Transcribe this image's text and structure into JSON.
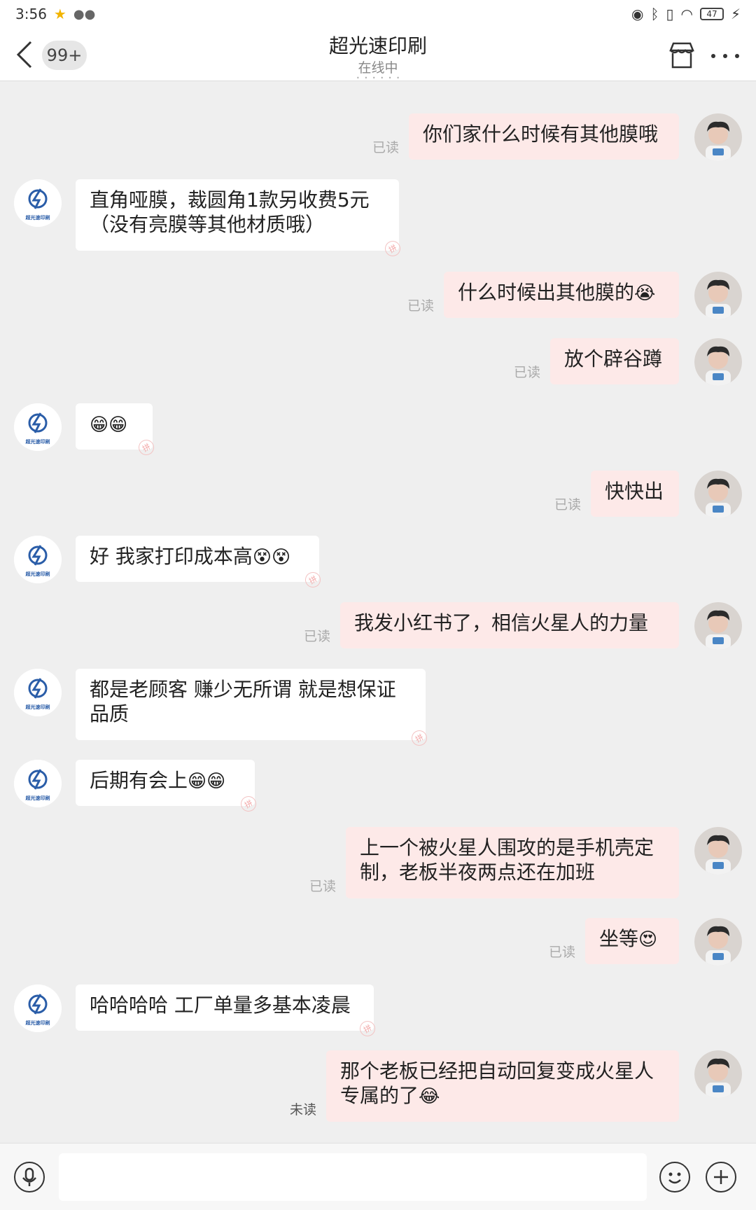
{
  "status_bar": {
    "time": "3:56",
    "battery": "47"
  },
  "header": {
    "unread_count": "99+",
    "title": "超光速印刷",
    "status": "在线中"
  },
  "messages": [
    {
      "side": "right",
      "text": "你们家什么时候有其他膜哦",
      "read": "已读"
    },
    {
      "side": "left",
      "text": "直角哑膜，裁圆角1款另收费5元\n（没有亮膜等其他材质哦）"
    },
    {
      "side": "right",
      "text": "什么时候出其他膜的",
      "emoji": "😭",
      "read": "已读"
    },
    {
      "side": "right",
      "text": "放个辟谷蹲",
      "read": "已读"
    },
    {
      "side": "left",
      "text": "",
      "emoji": "😁😁"
    },
    {
      "side": "right",
      "text": "快快出",
      "read": "已读"
    },
    {
      "side": "left",
      "text": "好 我家打印成本高",
      "emoji": "😵😵"
    },
    {
      "side": "right",
      "text": "我发小红书了，相信火星人的力量",
      "read": "已读"
    },
    {
      "side": "left",
      "text": "都是老顾客 赚少无所谓 就是想保证\n品质"
    },
    {
      "side": "left",
      "text": "后期有会上",
      "emoji": "😁😁"
    },
    {
      "side": "right",
      "text": "上一个被火星人围攻的是手机壳定\n制，老板半夜两点还在加班",
      "read": "已读"
    },
    {
      "side": "right",
      "text": "坐等",
      "emoji": "😍",
      "read": "已读"
    },
    {
      "side": "left",
      "text": "哈哈哈哈 工厂单量多基本凌晨"
    },
    {
      "side": "right",
      "text": "那个老板已经把自动回复变成火星人\n专属的了",
      "emoji": "😂",
      "read": "未读"
    }
  ],
  "shop_logo_text": "超光速印刷",
  "watermark_char": "拼",
  "icons": {
    "back": "chevron-left-icon",
    "shop": "store-icon",
    "more": "more-dots-icon",
    "voice": "microphone-icon",
    "emoji": "smiley-icon",
    "plus": "plus-icon"
  },
  "colors": {
    "bubble_right": "#fde9e8",
    "bubble_left": "#ffffff",
    "background": "#efefef"
  }
}
